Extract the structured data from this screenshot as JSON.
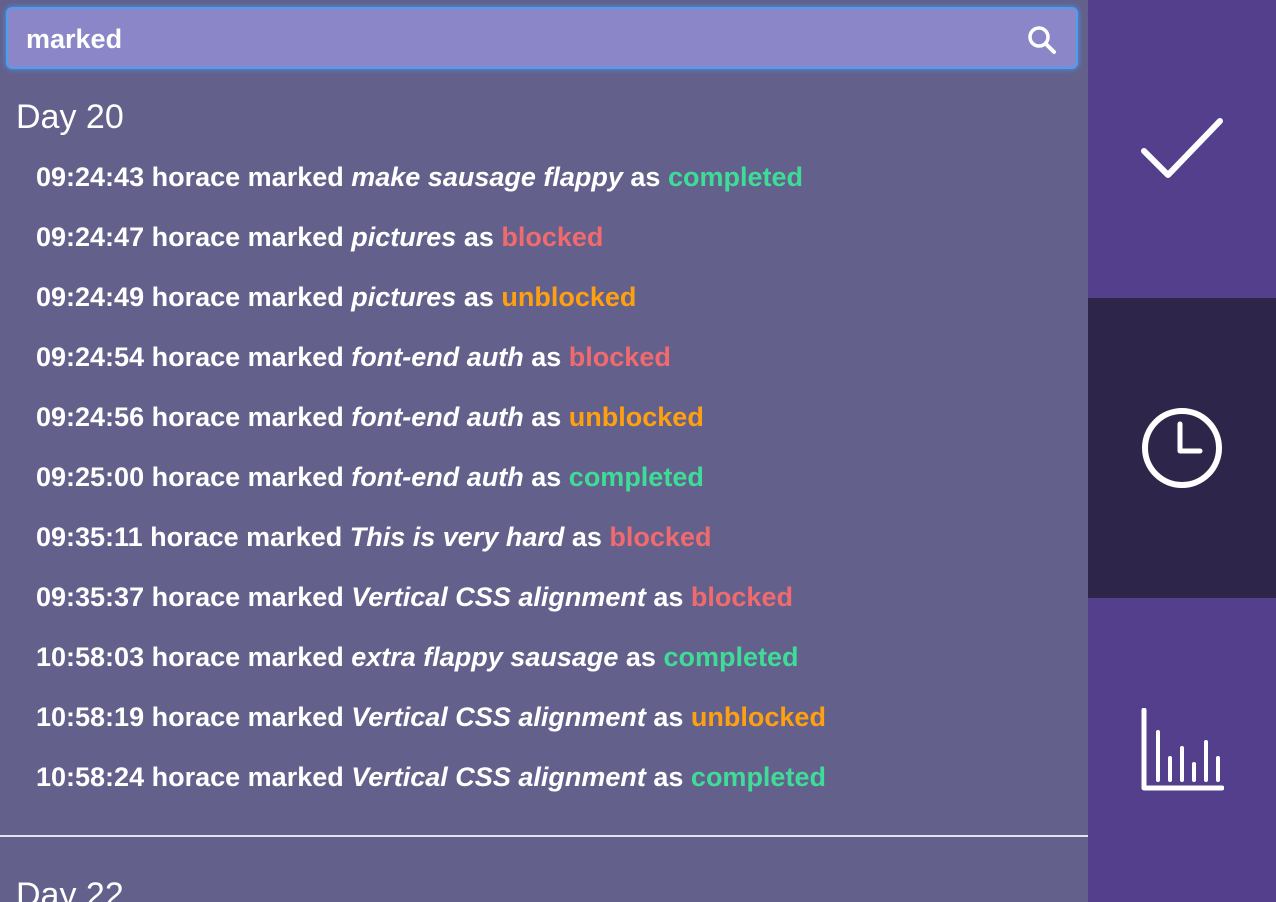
{
  "search": {
    "value": "marked"
  },
  "days": [
    {
      "title": "Day 20",
      "entries": [
        {
          "time": "09:24:43",
          "user": "horace",
          "verb": "marked",
          "task": "make sausage flappy",
          "as": "as",
          "status": "completed"
        },
        {
          "time": "09:24:47",
          "user": "horace",
          "verb": "marked",
          "task": "pictures",
          "as": "as",
          "status": "blocked"
        },
        {
          "time": "09:24:49",
          "user": "horace",
          "verb": "marked",
          "task": "pictures",
          "as": "as",
          "status": "unblocked"
        },
        {
          "time": "09:24:54",
          "user": "horace",
          "verb": "marked",
          "task": "font-end auth",
          "as": "as",
          "status": "blocked"
        },
        {
          "time": "09:24:56",
          "user": "horace",
          "verb": "marked",
          "task": "font-end auth",
          "as": "as",
          "status": "unblocked"
        },
        {
          "time": "09:25:00",
          "user": "horace",
          "verb": "marked",
          "task": "font-end auth",
          "as": "as",
          "status": "completed"
        },
        {
          "time": "09:35:11",
          "user": "horace",
          "verb": "marked",
          "task": "This is very hard",
          "as": "as",
          "status": "blocked"
        },
        {
          "time": "09:35:37",
          "user": "horace",
          "verb": "marked",
          "task": "Vertical CSS alignment",
          "as": "as",
          "status": "blocked"
        },
        {
          "time": "10:58:03",
          "user": "horace",
          "verb": "marked",
          "task": "extra flappy sausage",
          "as": "as",
          "status": "completed"
        },
        {
          "time": "10:58:19",
          "user": "horace",
          "verb": "marked",
          "task": "Vertical CSS alignment",
          "as": "as",
          "status": "unblocked"
        },
        {
          "time": "10:58:24",
          "user": "horace",
          "verb": "marked",
          "task": "Vertical CSS alignment",
          "as": "as",
          "status": "completed"
        }
      ]
    },
    {
      "title": "Day 22",
      "entries": []
    }
  ],
  "sidebar": {
    "items": [
      {
        "name": "tasks",
        "icon": "checkmark-icon",
        "active": false
      },
      {
        "name": "history",
        "icon": "clock-icon",
        "active": true
      },
      {
        "name": "stats",
        "icon": "bar-chart-icon",
        "active": false
      }
    ]
  },
  "colors": {
    "main_bg": "#63618c",
    "search_bg": "#8a86c8",
    "sidebar_bg": "#533f8c",
    "sidebar_active_bg": "#2e254b",
    "completed": "#3fdc98",
    "blocked": "#f06a6e",
    "unblocked": "#ffa010"
  }
}
